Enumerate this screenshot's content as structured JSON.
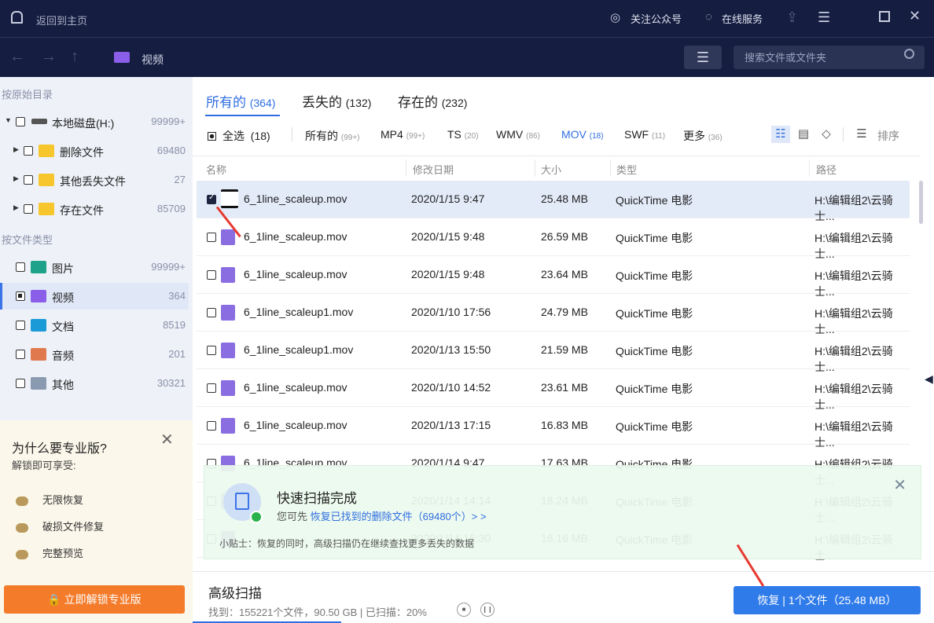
{
  "topbar": {
    "back_label": "返回到主页",
    "follow": "关注公众号",
    "service": "在线服务"
  },
  "nav": {
    "current_folder": "视频",
    "search_placeholder": "搜索文件或文件夹"
  },
  "sidebar": {
    "section_dir": "按原始目录",
    "dir_items": [
      {
        "label": "本地磁盘(H:)",
        "count": "99999+"
      },
      {
        "label": "删除文件",
        "count": "69480"
      },
      {
        "label": "其他丢失文件",
        "count": "27"
      },
      {
        "label": "存在文件",
        "count": "85709"
      }
    ],
    "section_type": "按文件类型",
    "type_items": [
      {
        "label": "图片",
        "count": "99999+"
      },
      {
        "label": "视频",
        "count": "364"
      },
      {
        "label": "文档",
        "count": "8519"
      },
      {
        "label": "音频",
        "count": "201"
      },
      {
        "label": "其他",
        "count": "30321"
      }
    ]
  },
  "promo": {
    "title": "为什么要专业版?",
    "subtitle": "解锁即可享受:",
    "features": [
      "无限恢复",
      "破损文件修复",
      "完整预览"
    ],
    "button": "立即解锁专业版"
  },
  "tabs": [
    {
      "label": "所有的",
      "count": "(364)"
    },
    {
      "label": "丢失的",
      "count": "(132)"
    },
    {
      "label": "存在的",
      "count": "(232)"
    }
  ],
  "filters": {
    "select_all": "全选",
    "select_count": "(18)",
    "items": [
      {
        "label": "所有的",
        "count": "(99+)"
      },
      {
        "label": "MP4",
        "count": "(99+)"
      },
      {
        "label": "TS",
        "count": "(20)"
      },
      {
        "label": "WMV",
        "count": "(86)"
      },
      {
        "label": "MOV",
        "count": "(18)"
      },
      {
        "label": "SWF",
        "count": "(11)"
      },
      {
        "label": "更多",
        "count": "(36)"
      }
    ],
    "sort": "排序"
  },
  "columns": [
    "名称",
    "修改日期",
    "大小",
    "类型",
    "路径"
  ],
  "rows": [
    {
      "name": "6_1line_scaleup.mov",
      "date": "2020/1/15 9:47",
      "size": "25.48 MB",
      "type": "QuickTime 电影",
      "path": "H:\\编辑组2\\云骑士...",
      "checked": true
    },
    {
      "name": "6_1line_scaleup.mov",
      "date": "2020/1/15 9:48",
      "size": "26.59 MB",
      "type": "QuickTime 电影",
      "path": "H:\\编辑组2\\云骑士..."
    },
    {
      "name": "6_1line_scaleup.mov",
      "date": "2020/1/15 9:48",
      "size": "23.64 MB",
      "type": "QuickTime 电影",
      "path": "H:\\编辑组2\\云骑士..."
    },
    {
      "name": "6_1line_scaleup1.mov",
      "date": "2020/1/10 17:56",
      "size": "24.79 MB",
      "type": "QuickTime 电影",
      "path": "H:\\编辑组2\\云骑士..."
    },
    {
      "name": "6_1line_scaleup1.mov",
      "date": "2020/1/13 15:50",
      "size": "21.59 MB",
      "type": "QuickTime 电影",
      "path": "H:\\编辑组2\\云骑士..."
    },
    {
      "name": "6_1line_scaleup.mov",
      "date": "2020/1/10 14:52",
      "size": "23.61 MB",
      "type": "QuickTime 电影",
      "path": "H:\\编辑组2\\云骑士..."
    },
    {
      "name": "6_1line_scaleup.mov",
      "date": "2020/1/13 17:15",
      "size": "16.83 MB",
      "type": "QuickTime 电影",
      "path": "H:\\编辑组2\\云骑士..."
    },
    {
      "name": "6_1line_scaleup.mov",
      "date": "2020/1/14 9:47",
      "size": "17.63 MB",
      "type": "QuickTime 电影",
      "path": "H:\\编辑组2\\云骑士..."
    },
    {
      "name": "",
      "date": "2020/1/14 14:14",
      "size": "18.24 MB",
      "type": "QuickTime 电影",
      "path": "H:\\编辑组2\\云骑士..."
    },
    {
      "name": "",
      "date": "2020/1/14 15:30",
      "size": "16.16 MB",
      "type": "QuickTime 电影",
      "path": "H:\\编辑组2\\云骑士..."
    }
  ],
  "toast": {
    "title": "快速扫描完成",
    "prefix": "您可先",
    "link": "恢复已找到的删除文件（69480个）> >",
    "tip": "小贴士：恢复的同时，高级扫描仍在继续查找更多丢失的数据"
  },
  "bottom": {
    "title": "高级扫描",
    "status": "找到：155221个文件，90.50 GB | 已扫描：20%",
    "progress_percent": 20,
    "recover_button": "恢复 | 1个文件（25.48 MB）"
  },
  "colors": {
    "accent": "#2f6ee0",
    "topbar": "#151d40",
    "unlock": "#f47b2a"
  }
}
